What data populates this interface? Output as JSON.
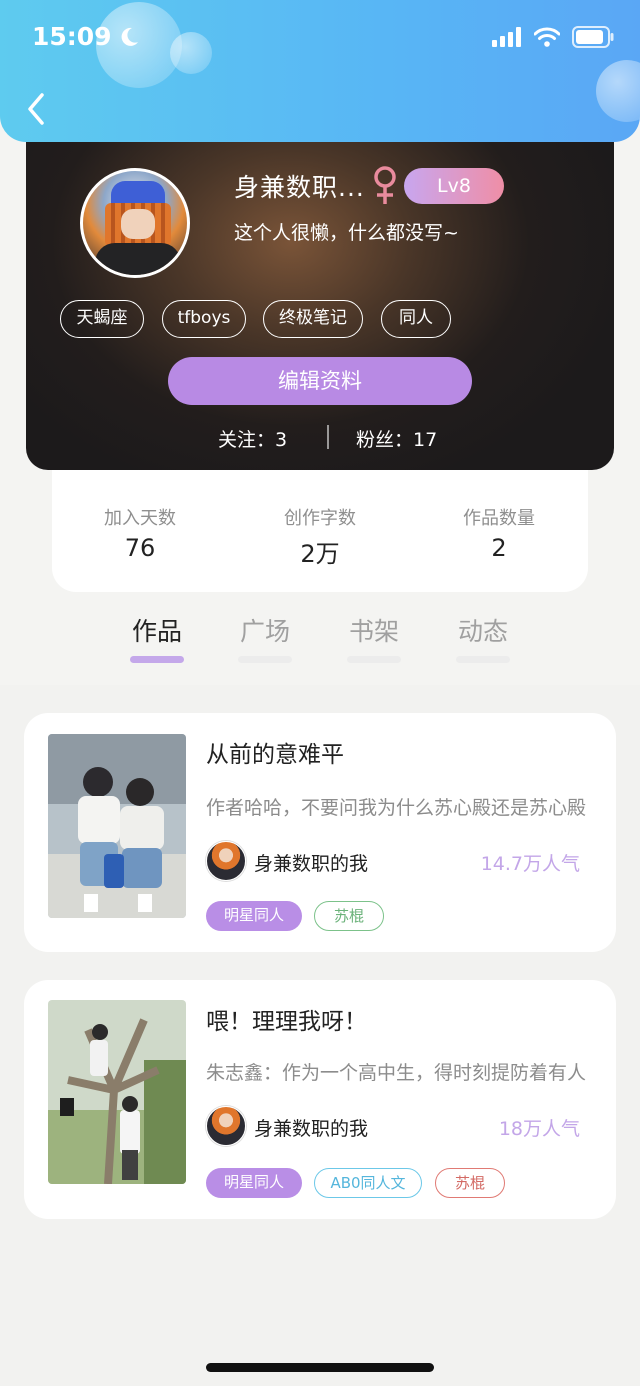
{
  "status_bar": {
    "time": "15:09"
  },
  "profile": {
    "username": "身兼数职...",
    "gender_symbol": "♀",
    "level": "Lv8",
    "bio": "这个人很懒，什么都没写~",
    "tags": [
      "天蝎座",
      "tfboys",
      "终极笔记",
      "同人"
    ],
    "edit_button": "编辑资料",
    "following_label": "关注：3",
    "followers_label": "粉丝：17"
  },
  "stats": [
    {
      "label": "加入天数",
      "value": "76"
    },
    {
      "label": "创作字数",
      "value": "2万"
    },
    {
      "label": "作品数量",
      "value": "2"
    }
  ],
  "tabs": [
    {
      "label": "作品",
      "active": true
    },
    {
      "label": "广场",
      "active": false
    },
    {
      "label": "书架",
      "active": false
    },
    {
      "label": "动态",
      "active": false
    }
  ],
  "works": [
    {
      "title": "从前的意难平",
      "desc": "作者哈哈，不要问我为什么苏心殿还是苏心殿",
      "author": "身兼数职的我",
      "popularity": "14.7万人气",
      "tags": [
        "明星同人",
        "苏棍"
      ]
    },
    {
      "title": "喂！理理我呀！",
      "desc": "朱志鑫：作为一个高中生，得时刻提防着有人",
      "author": "身兼数职的我",
      "popularity": "18万人气",
      "tags": [
        "明星同人",
        "AB0同人文",
        "苏棍"
      ]
    }
  ],
  "colors": {
    "header_blue": "#5ab6f5",
    "accent_purple": "#b88ae4",
    "popularity_purple": "#c3a6e8",
    "tag_green": "#7cc28a",
    "tag_blue": "#6cc8e8",
    "tag_red": "#e07a74"
  }
}
